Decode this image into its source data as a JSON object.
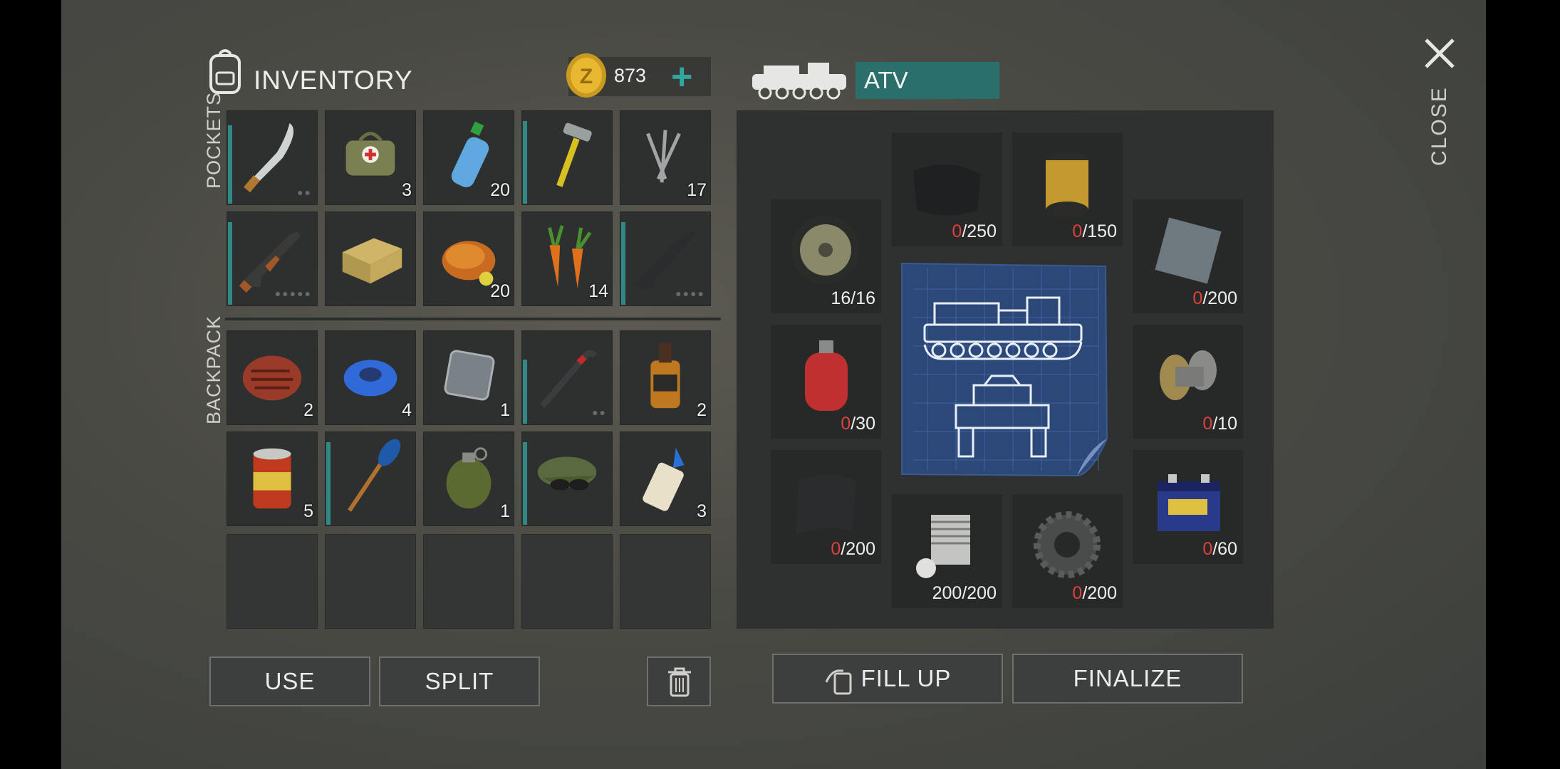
{
  "inventory": {
    "title": "INVENTORY",
    "coins": "873",
    "pockets_label": "POCKETS",
    "backpack_label": "BACKPACK",
    "pockets": [
      {
        "icon": "machete-icon",
        "count": "",
        "durability": 0.85,
        "dots": "●●"
      },
      {
        "icon": "first-aid-bag-icon",
        "count": "3"
      },
      {
        "icon": "water-bottle-icon",
        "count": "20"
      },
      {
        "icon": "hammer-icon",
        "count": "",
        "durability": 0.9
      },
      {
        "icon": "nails-icon",
        "count": "17"
      },
      {
        "icon": "ak-rifle-icon",
        "count": "",
        "durability": 0.9,
        "dots": "●●●●●"
      },
      {
        "icon": "ammo-crate-icon",
        "count": ""
      },
      {
        "icon": "roast-chicken-icon",
        "count": "20"
      },
      {
        "icon": "carrots-icon",
        "count": "14"
      },
      {
        "icon": "m16-rifle-icon",
        "count": "",
        "durability": 0.9,
        "dots": "●●●●"
      }
    ],
    "backpack": [
      {
        "icon": "steak-icon",
        "count": "2"
      },
      {
        "icon": "duct-tape-icon",
        "count": "4"
      },
      {
        "icon": "metal-plate-icon",
        "count": "1"
      },
      {
        "icon": "crowbar-icon",
        "count": "",
        "durability": 0.7,
        "dots": "●●"
      },
      {
        "icon": "whiskey-bottle-icon",
        "count": "2"
      },
      {
        "icon": "food-can-icon",
        "count": "5"
      },
      {
        "icon": "paddle-icon",
        "count": "",
        "durability": 0.9
      },
      {
        "icon": "grenade-icon",
        "count": "1"
      },
      {
        "icon": "camo-cap-sunglasses-icon",
        "count": "",
        "durability": 0.9
      },
      {
        "icon": "glue-tube-icon",
        "count": "3"
      }
    ]
  },
  "vehicle": {
    "name": "ATV",
    "parts": [
      {
        "icon": "black-cloth-icon",
        "have": "0",
        "need": "/250"
      },
      {
        "icon": "air-filter-icon",
        "have": "0",
        "need": "/150"
      },
      {
        "icon": "wheel-icon",
        "have": "16",
        "need": "/16"
      },
      {
        "icon": "steel-sheet-icon",
        "have": "0",
        "need": "/200"
      },
      {
        "icon": "gas-cylinder-icon",
        "have": "0",
        "need": "/30"
      },
      {
        "icon": "transmission-icon",
        "have": "0",
        "need": "/10"
      },
      {
        "icon": "rubber-sheet-icon",
        "have": "0",
        "need": "/200"
      },
      {
        "icon": "car-battery-icon",
        "have": "0",
        "need": "/60"
      },
      {
        "icon": "engine-cylinder-icon",
        "have": "200",
        "need": "/200"
      },
      {
        "icon": "gear-icon",
        "have": "0",
        "need": "/200"
      }
    ]
  },
  "buttons": {
    "use": "USE",
    "split": "SPLIT",
    "fill_up": "FILL UP",
    "finalize": "FINALIZE",
    "close": "CLOSE"
  },
  "colors": {
    "accent": "#2a6f6b",
    "missing": "#e0403a",
    "plus": "#30a8a0"
  }
}
